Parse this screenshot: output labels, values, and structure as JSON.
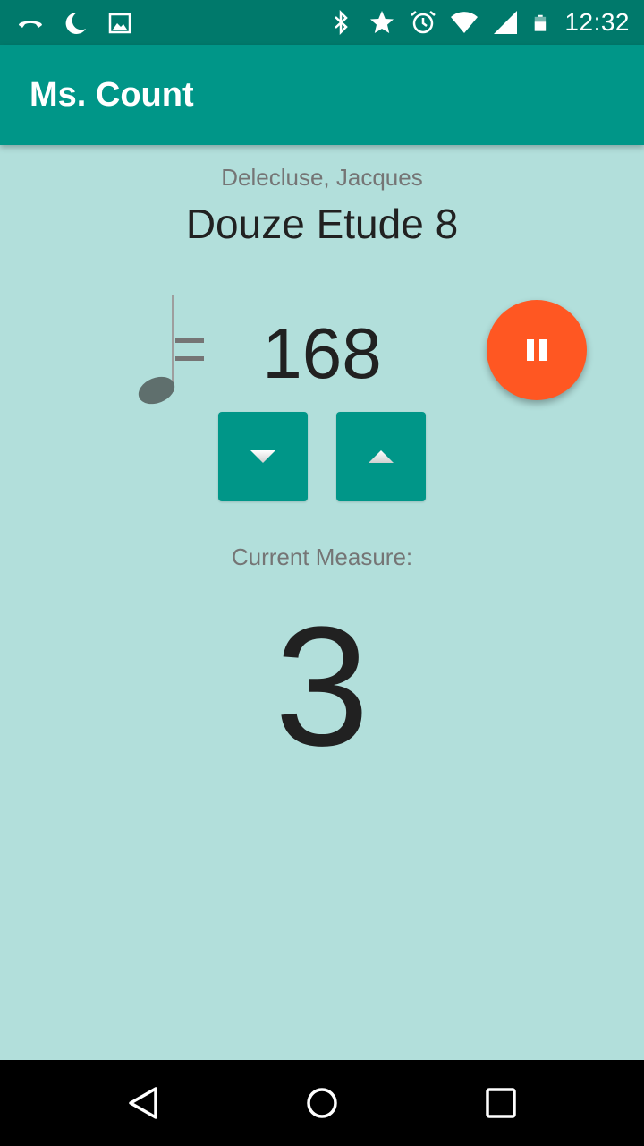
{
  "status_bar": {
    "time": "12:32",
    "left_icons": [
      "phone-hangup-icon",
      "moon-icon",
      "image-icon"
    ],
    "right_icons": [
      "bluetooth-icon",
      "star-icon",
      "alarm-icon",
      "wifi-icon",
      "cell-signal-icon",
      "battery-icon"
    ]
  },
  "app_bar": {
    "title": "Ms. Count"
  },
  "piece": {
    "composer": "Delecluse, Jacques",
    "title": "Douze Etude 8"
  },
  "tempo": {
    "value": "168",
    "note_icon": "quarter-note-icon",
    "equals": "=",
    "decrease_icon": "arrow-down-icon",
    "increase_icon": "arrow-up-icon"
  },
  "playback": {
    "state_icon": "pause-icon",
    "color": "#ff5722"
  },
  "measure": {
    "label": "Current Measure:",
    "value": "3"
  },
  "colors": {
    "primary": "#009688",
    "primary_dark": "#00796b",
    "background": "#b2dfdb",
    "accent": "#ff5722"
  },
  "nav_bar": {
    "icons": [
      "back-icon",
      "home-icon",
      "recents-icon"
    ]
  }
}
